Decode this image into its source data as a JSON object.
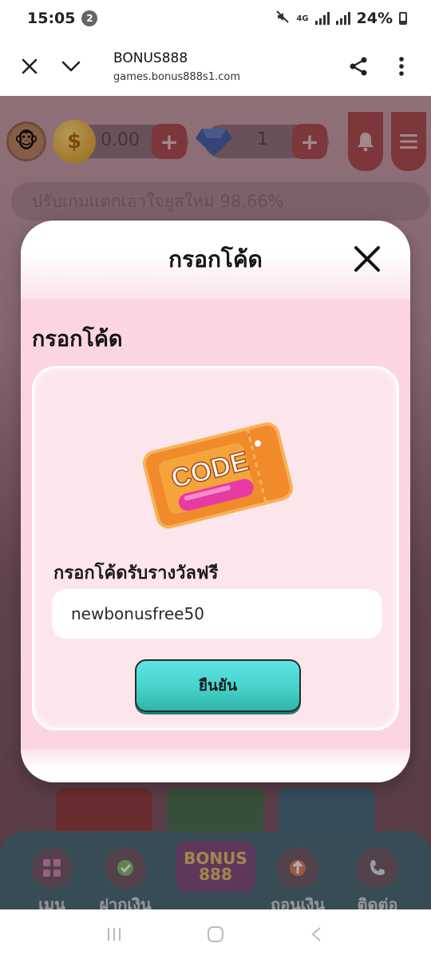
{
  "status_bar": {
    "time": "15:05",
    "notification_count": "2",
    "network": "4G",
    "battery": "24%"
  },
  "browser": {
    "title": "BONUS888",
    "url": "games.bonus888s1.com"
  },
  "game": {
    "coin_balance": "0.00",
    "gem_count": "1",
    "marquee_text": "ปรับเกมแตกเอาใจยูสใหม่ 98.66%",
    "logo_line1": "BONUS",
    "logo_line2": "888",
    "nav": {
      "menu": "เมนู",
      "deposit": "ฝากเงิน",
      "withdraw": "ถอนเงิน",
      "contact": "ติดต่อ"
    }
  },
  "modal": {
    "title": "กรอกโค้ด",
    "section_title": "กรอกโค้ด",
    "code_image_text": "CODE",
    "field_label": "กรอกโค้ดรับรางวัลฟรี",
    "input_value": "newbonusfree50",
    "confirm_label": "ยืนยัน"
  },
  "colors": {
    "modal_body": "#fbd6e1",
    "confirm_button": "#45d3c9",
    "ticket_orange": "#f08a2a",
    "ticket_pink": "#e83aa3"
  }
}
